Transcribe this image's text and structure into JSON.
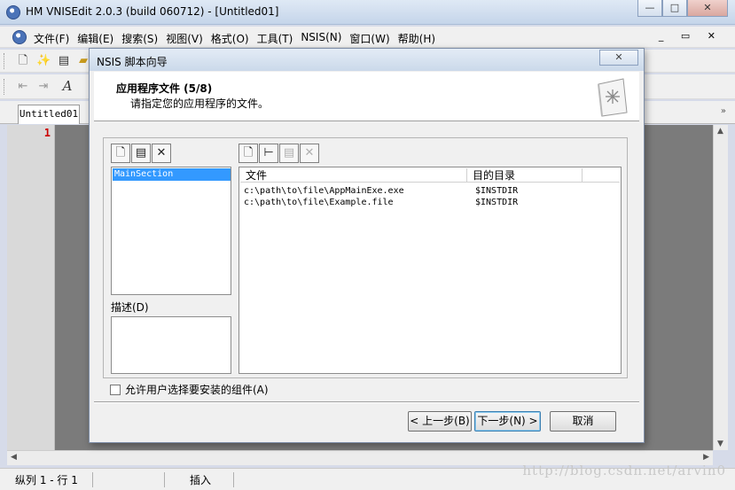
{
  "window": {
    "title": "HM VNISEdit 2.0.3 (build 060712) - [Untitled01]",
    "min": "—",
    "max": "□",
    "close": "✕"
  },
  "menu": [
    "文件(F)",
    "编辑(E)",
    "搜索(S)",
    "视图(V)",
    "格式(O)",
    "工具(T)",
    "NSIS(N)",
    "窗口(W)",
    "帮助(H)"
  ],
  "mdi_controls": "_ ▭ ✕",
  "tabs": {
    "active": "Untitled01"
  },
  "editor": {
    "line_number": "1"
  },
  "dialog": {
    "title": "NSIS 脚本向导",
    "close": "✕",
    "heading": "应用程序文件 (5/8)",
    "subheading": "请指定您的应用程序的文件。",
    "sections": [
      "MainSection"
    ],
    "description_label": "描述(D)",
    "columns": [
      "文件",
      "目的目录"
    ],
    "files": [
      {
        "file": "c:\\path\\to\\file\\AppMainExe.exe",
        "dest": "$INSTDIR"
      },
      {
        "file": "c:\\path\\to\\file\\Example.file",
        "dest": "$INSTDIR"
      }
    ],
    "checkbox_label": "允许用户选择要安装的组件(A)",
    "buttons": {
      "back": "< 上一步(B)",
      "next": "下一步(N) >",
      "cancel": "取消"
    }
  },
  "status": {
    "position": "纵列 1 - 行 1",
    "mode": "插入"
  },
  "watermark": "http://blog.csdn.net/arvin0"
}
